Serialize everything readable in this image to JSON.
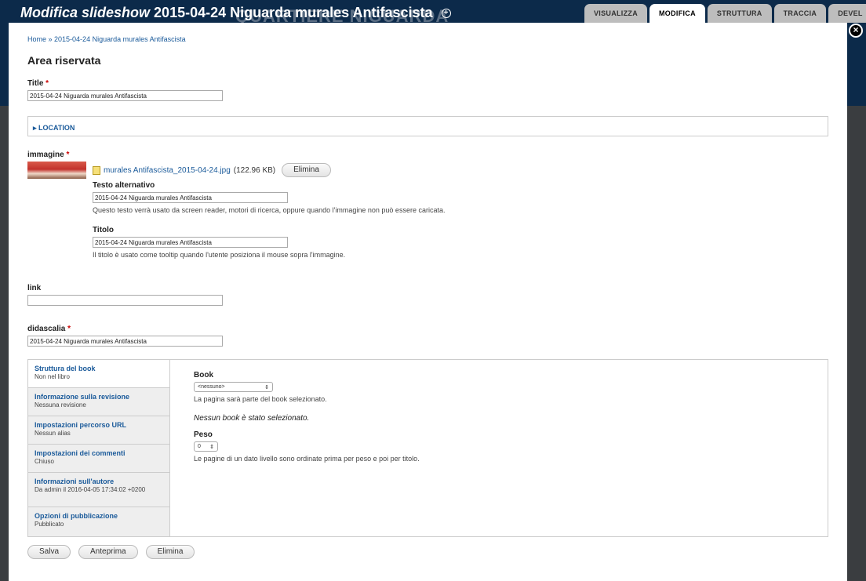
{
  "overlay": {
    "title_em": "Modifica slideshow",
    "title_rest": "2015-04-24 Niguarda murales Antifascista",
    "bg_watermark": "QUARTIERE NIGUARDA",
    "tabs": [
      "VISUALIZZA",
      "MODIFICA",
      "STRUTTURA",
      "TRACCIA",
      "DEVEL"
    ],
    "active_tab": "MODIFICA"
  },
  "breadcrumb": {
    "home": "Home",
    "sep": " » ",
    "current": "2015-04-24 Niguarda murales Antifascista"
  },
  "page_title": "Area riservata",
  "title_field": {
    "label": "Title",
    "required": "*",
    "value": "2015-04-24 Niguarda murales Antifascista"
  },
  "location": {
    "label": "LOCATION"
  },
  "image_field": {
    "label": "immagine",
    "required": "*",
    "file_name": "murales Antifascista_2015-04-24.jpg",
    "file_size": "(122.96 KB)",
    "remove_label": "Elimina",
    "alt": {
      "label": "Testo alternativo",
      "value": "2015-04-24 Niguarda murales Antifascista",
      "desc": "Questo testo verrà usato da screen reader, motori di ricerca, oppure quando l'immagine non può essere caricata."
    },
    "title": {
      "label": "Titolo",
      "value": "2015-04-24 Niguarda murales Antifascista",
      "desc": "Il titolo è usato come tooltip quando l'utente posiziona il mouse sopra l'immagine."
    }
  },
  "link_field": {
    "label": "link",
    "value": ""
  },
  "didascalia_field": {
    "label": "didascalia",
    "required": "*",
    "value": "2015-04-24 Niguarda murales Antifascista"
  },
  "vtabs": [
    {
      "title": "Struttura del book",
      "summary": "Non nel libro"
    },
    {
      "title": "Informazione sulla revisione",
      "summary": "Nessuna revisione"
    },
    {
      "title": "Impostazioni percorso URL",
      "summary": "Nessun alias"
    },
    {
      "title": "Impostazioni dei commenti",
      "summary": "Chiuso"
    },
    {
      "title": "Informazioni sull'autore",
      "summary": "Da admin il 2016-04-05 17:34:02 +0200"
    },
    {
      "title": "Opzioni di pubblicazione",
      "summary": "Pubblicato"
    }
  ],
  "book_pane": {
    "book_label": "Book",
    "book_value": "<nessuno>",
    "book_desc": "La pagina sarà parte del book selezionato.",
    "no_book": "Nessun book è stato selezionato.",
    "peso_label": "Peso",
    "peso_value": "0",
    "peso_desc": "Le pagine di un dato livello sono ordinate prima per peso e poi per titolo."
  },
  "actions": {
    "save": "Salva",
    "preview": "Anteprima",
    "delete": "Elimina"
  },
  "close_icon_glyph": "×",
  "colors": {
    "link": "#1a5a9a",
    "required": "#cc0000",
    "header_band": "#0c2a4a"
  }
}
